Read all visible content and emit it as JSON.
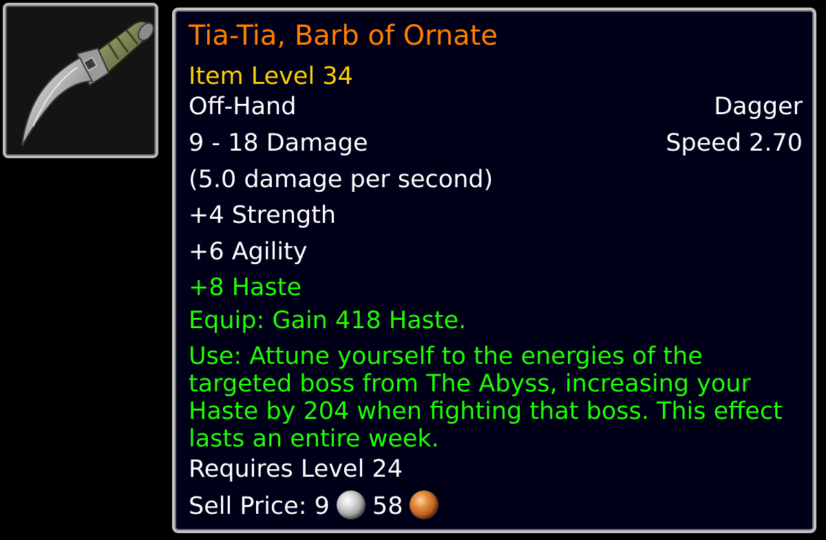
{
  "item": {
    "icon": "dagger-icon",
    "name": "Tia-Tia, Barb of Ornate",
    "item_level": "Item Level 34",
    "slot": "Off-Hand",
    "type": "Dagger",
    "damage": "9 - 18 Damage",
    "speed": "Speed 2.70",
    "dps": "(5.0 damage per second)",
    "stats": [
      "+4 Strength",
      "+6 Agility"
    ],
    "green_stat": "+8 Haste",
    "equip": "Equip: Gain 418 Haste.",
    "use": "Use: Attune yourself to the energies of the targeted boss from The Abyss, increasing your Haste by 204 when fighting that boss. This effect lasts an entire week.",
    "requirement": "Requires Level 24",
    "sell_price": {
      "label": "Sell Price:",
      "silver": "9",
      "copper": "58",
      "silver_icon": "silver-coin-icon",
      "copper_icon": "copper-coin-icon"
    }
  },
  "colors": {
    "name_quality": "#ff8000",
    "item_level": "#ffd100",
    "green_text": "#1eff00",
    "normal_text": "#ffffff",
    "tooltip_background": "#000018"
  }
}
